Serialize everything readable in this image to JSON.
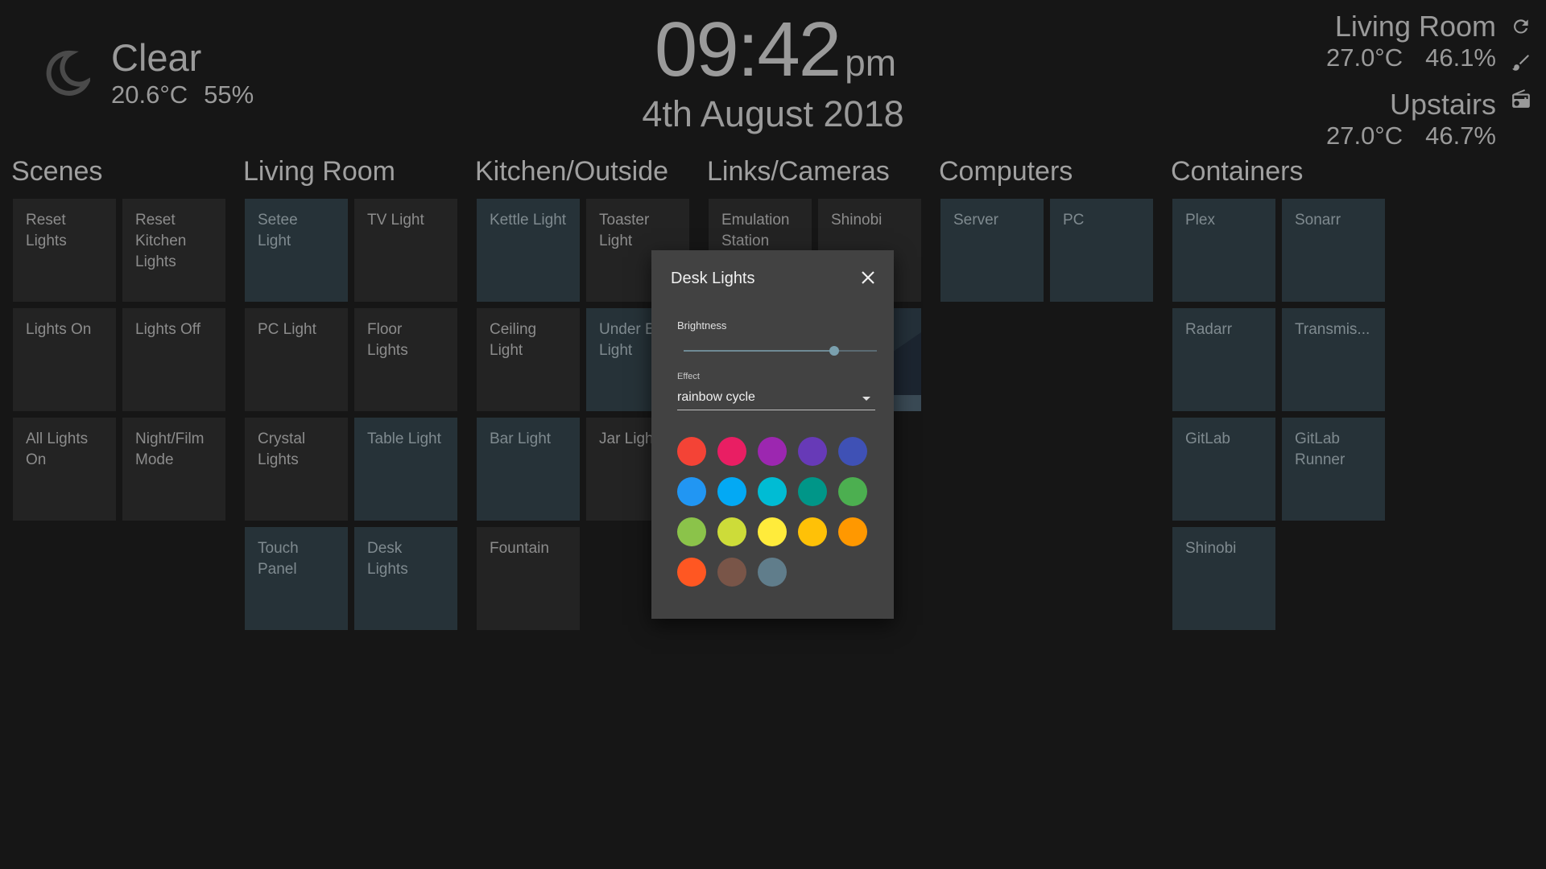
{
  "weather": {
    "condition": "Clear",
    "temperature": "20.6°C",
    "humidity": "55%",
    "icon": "moon-icon"
  },
  "clock": {
    "time": "09:42",
    "ampm": "pm",
    "date": "4th August 2018"
  },
  "sensors": [
    {
      "name": "Living Room",
      "temperature": "27.0°C",
      "humidity": "46.1%"
    },
    {
      "name": "Upstairs",
      "temperature": "27.0°C",
      "humidity": "46.7%"
    }
  ],
  "side_icons": [
    "refresh-icon",
    "brush-icon",
    "radio-icon"
  ],
  "groups": [
    {
      "title": "Scenes",
      "tiles": [
        {
          "label": "Reset Lights",
          "on": false
        },
        {
          "label": "Reset Kitchen Lights",
          "on": false
        },
        {
          "label": "Lights On",
          "on": false
        },
        {
          "label": "Lights Off",
          "on": false
        },
        {
          "label": "All Lights On",
          "on": false
        },
        {
          "label": "Night/Film Mode",
          "on": false
        }
      ]
    },
    {
      "title": "Living Room",
      "tiles": [
        {
          "label": "Setee Light",
          "on": true
        },
        {
          "label": "TV Light",
          "on": false
        },
        {
          "label": "PC Light",
          "on": false
        },
        {
          "label": "Floor Lights",
          "on": false
        },
        {
          "label": "Crystal Lights",
          "on": false
        },
        {
          "label": "Table Light",
          "on": true
        },
        {
          "label": "Touch Panel",
          "on": true
        },
        {
          "label": "Desk Lights",
          "on": true
        }
      ]
    },
    {
      "title": "Kitchen/Outside",
      "tiles": [
        {
          "label": "Kettle Light",
          "on": true
        },
        {
          "label": "Toaster Light",
          "on": false
        },
        {
          "label": "Ceiling Light",
          "on": false
        },
        {
          "label": "Under Bed Light",
          "on": true
        },
        {
          "label": "Bar Light",
          "on": true
        },
        {
          "label": "Jar Lights",
          "on": false
        },
        {
          "label": "Fountain",
          "on": false
        }
      ]
    },
    {
      "title": "Links/Cameras",
      "tiles": [
        {
          "label": "Emulation Station",
          "on": false
        },
        {
          "label": "Shinobi",
          "on": false
        },
        {
          "label": "",
          "on": false,
          "image": true
        },
        {
          "label": "",
          "on": false,
          "image": true
        },
        {
          "label": "",
          "on": false,
          "image": true
        },
        {
          "label": "",
          "on": false,
          "image": true
        }
      ]
    },
    {
      "title": "Computers",
      "tiles": [
        {
          "label": "Server",
          "on": true
        },
        {
          "label": "PC",
          "on": true
        }
      ]
    },
    {
      "title": "Containers",
      "tiles": [
        {
          "label": "Plex",
          "on": true
        },
        {
          "label": "Sonarr",
          "on": true
        },
        {
          "label": "Radarr",
          "on": true
        },
        {
          "label": "Transmis...",
          "on": true
        },
        {
          "label": "GitLab",
          "on": true
        },
        {
          "label": "GitLab Runner",
          "on": true
        },
        {
          "label": "Shinobi",
          "on": true
        }
      ]
    }
  ],
  "dialog": {
    "title": "Desk Lights",
    "brightness_label": "Brightness",
    "brightness": 0.78,
    "effect_label": "Effect",
    "effect_value": "rainbow cycle",
    "colors": [
      "#f44336",
      "#e91e63",
      "#9c27b0",
      "#673ab7",
      "#3f51b5",
      "#2196f3",
      "#03a9f4",
      "#00bcd4",
      "#009688",
      "#4caf50",
      "#8bc34a",
      "#cddc39",
      "#ffeb3b",
      "#ffc107",
      "#ff9800",
      "#ff5722",
      "#795548",
      "#607d8b"
    ]
  }
}
